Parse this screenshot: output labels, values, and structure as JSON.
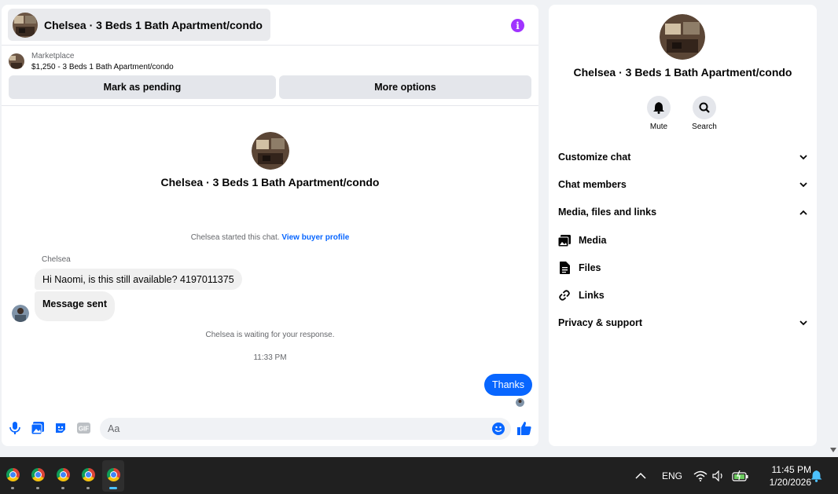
{
  "chat": {
    "title": "Chelsea · 3 Beds 1 Bath Apartment/condo",
    "marketplace_label": "Marketplace",
    "listing": "$1,250 - 3 Beds 1 Bath Apartment/condo",
    "mark_pending": "Mark as pending",
    "more_options": "More options",
    "intro_name": "Chelsea · 3 Beds 1 Bath Apartment/condo",
    "started_text": "Chelsea started this chat.",
    "view_profile": "View buyer profile",
    "sender": "Chelsea",
    "messages": [
      {
        "text": "Hi Naomi, is this still available? 4197011375",
        "direction": "in"
      },
      {
        "text": "Message sent",
        "direction": "in"
      },
      {
        "text": "Thanks",
        "direction": "out"
      }
    ],
    "waiting_text": "Chelsea is waiting for your response.",
    "timestamp": "11:33 PM",
    "composer_placeholder": "Aa",
    "accent": "#0866ff"
  },
  "info": {
    "name": "Chelsea · 3 Beds 1 Bath Apartment/condo",
    "mute": "Mute",
    "search": "Search",
    "sections": {
      "customize": "Customize chat",
      "members": "Chat members",
      "media_files_links": "Media, files and links",
      "privacy": "Privacy & support"
    },
    "sub_items": {
      "media": "Media",
      "files": "Files",
      "links": "Links"
    }
  },
  "taskbar": {
    "apps": [
      "chrome",
      "chrome",
      "chrome",
      "chrome",
      "chrome"
    ],
    "active_index": 4,
    "lang": "ENG",
    "time": "11:45 PM",
    "date": "1/20/2026"
  }
}
